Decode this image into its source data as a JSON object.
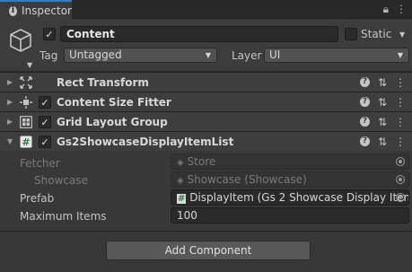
{
  "tab": {
    "icon": "info-icon",
    "label": "Inspector"
  },
  "header": {
    "name": "Content",
    "active": true,
    "static_label": "Static",
    "tag_label": "Tag",
    "tag_value": "Untagged",
    "layer_label": "Layer",
    "layer_value": "UI"
  },
  "components": [
    {
      "title": "Rect Transform",
      "icon": "rect-transform-icon",
      "has_checkbox": false
    },
    {
      "title": "Content Size Fitter",
      "icon": "content-size-fitter-icon",
      "has_checkbox": true,
      "enabled": true
    },
    {
      "title": "Grid Layout Group",
      "icon": "grid-layout-icon",
      "has_checkbox": true,
      "enabled": true
    },
    {
      "title": "Gs2ShowcaseDisplayItemList",
      "icon": "script-icon",
      "has_checkbox": true,
      "enabled": true,
      "expanded": true
    }
  ],
  "properties": {
    "fetcher_label": "Fetcher",
    "fetcher_value": "Store",
    "showcase_label": "Showcase",
    "showcase_value": "Showcase (Showcase)",
    "prefab_label": "Prefab",
    "prefab_value": "DisplayItem (Gs 2 Showcase Display Item",
    "max_items_label": "Maximum Items",
    "max_items_value": "100"
  },
  "add_component_label": "Add Component"
}
